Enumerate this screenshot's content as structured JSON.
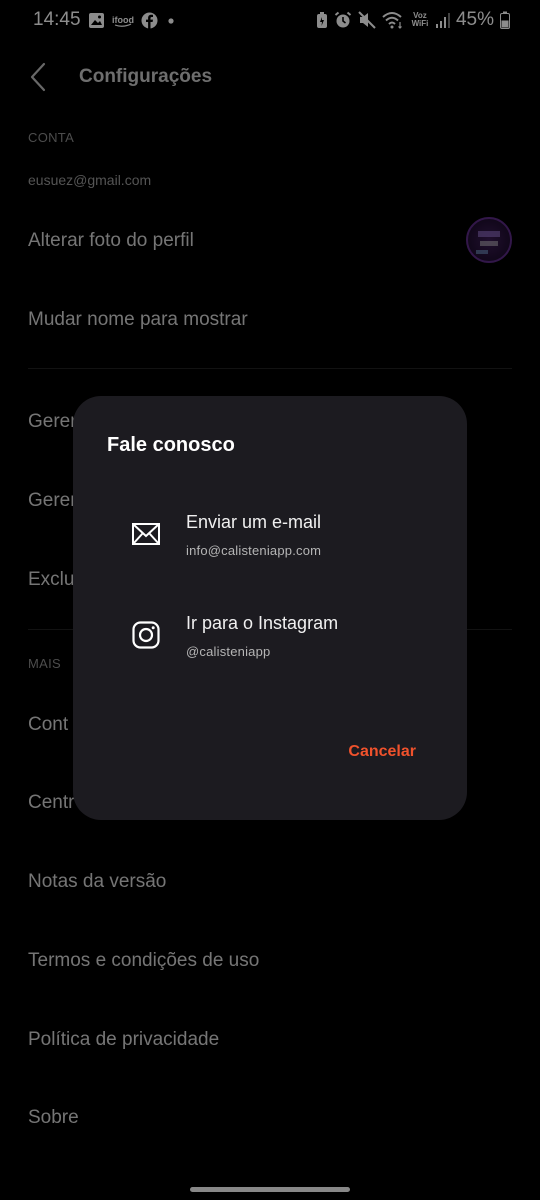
{
  "status_bar": {
    "time": "14:45",
    "battery_text": "45%",
    "voz_wifi": "Voz WiFi",
    "left_icons": [
      "gallery-icon",
      "ifood-icon",
      "facebook-icon",
      "dot-icon"
    ],
    "right_icons": [
      "battery-saver-icon",
      "alarm-icon",
      "mute-icon",
      "wifi-icon",
      "signal-icon",
      "battery-icon"
    ]
  },
  "header": {
    "title": "Configurações"
  },
  "account": {
    "section_label": "CONTA",
    "email": "eusuez@gmail.com",
    "items": [
      "Alterar foto do perfil",
      "Mudar nome para mostrar"
    ],
    "obscured_items": [
      "Geren",
      "Geren",
      "Exclu"
    ]
  },
  "more": {
    "section_label": "MAIS",
    "obscured_items": [
      "Cont",
      "Centr"
    ],
    "items": [
      "Notas da versão",
      "Termos e condições de uso",
      "Política de privacidade",
      "Sobre"
    ]
  },
  "dialog": {
    "title": "Fale conosco",
    "options": [
      {
        "label": "Enviar um e-mail",
        "sub": "info@calisteniapp.com",
        "icon": "mail-icon"
      },
      {
        "label": "Ir para o Instagram",
        "sub": "@calisteniapp",
        "icon": "instagram-icon"
      }
    ],
    "cancel_label": "Cancelar"
  },
  "colors": {
    "accent": "#f0522c",
    "dialog_bg": "#1c1b20",
    "background": "#000000"
  }
}
